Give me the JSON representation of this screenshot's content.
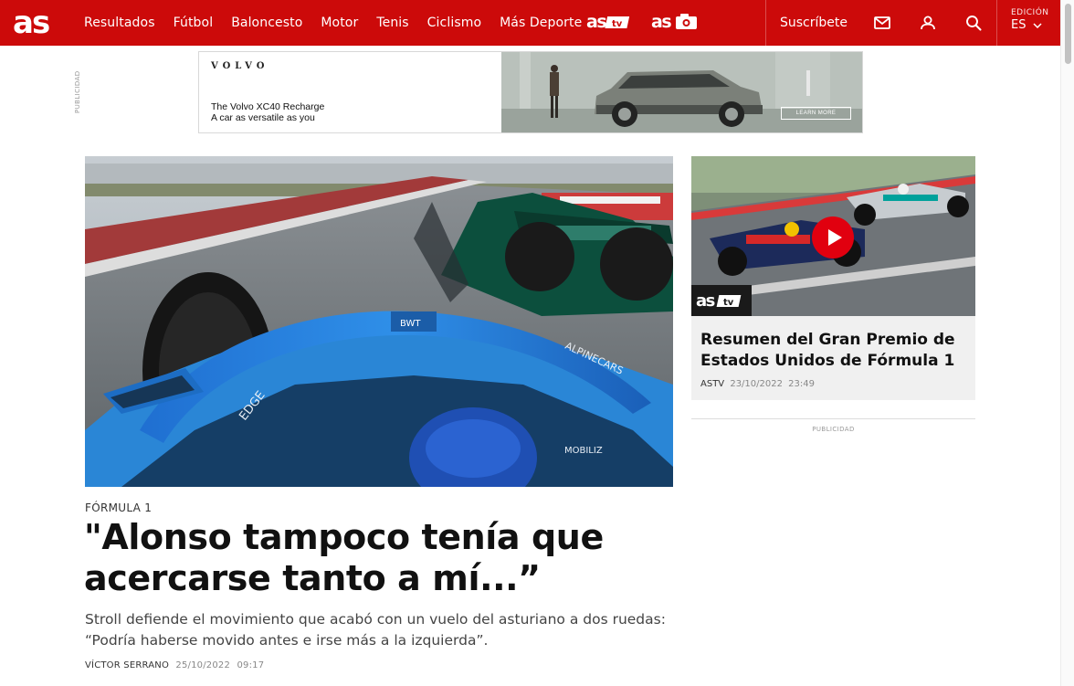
{
  "header": {
    "nav": [
      "Resultados",
      "Fútbol",
      "Baloncesto",
      "Motor",
      "Tenis",
      "Ciclismo",
      "Más Deporte"
    ],
    "subscribe_label": "Suscríbete",
    "edition_label": "EDICIÓN",
    "edition_value": "ES",
    "brand_color": "#cc0a0a"
  },
  "top_ad": {
    "label": "PUBLICIDAD",
    "brand": "VOLVO",
    "line1": "The Volvo XC40 Recharge",
    "line2": "A car as versatile as you",
    "cta": "LEARN MORE"
  },
  "main_article": {
    "kicker": "FÓRMULA 1",
    "title": "\"Alonso tampoco tenía que acercarse tanto a mí...”",
    "standfirst": "Stroll defiende el movimiento que acabó con un vuelo del asturiano a dos ruedas: “Podría haberse movido antes e irse más a la izquierda”.",
    "author": "VÍCTOR SERRANO",
    "date": "25/10/2022",
    "time": "09:17"
  },
  "side_article": {
    "title": "Resumen del Gran Premio de Estados Unidos de Fórmula 1",
    "source": "ASTV",
    "date": "23/10/2022",
    "time": "23:49",
    "play_color": "#e1000f"
  },
  "side_ad": {
    "label": "PUBLICIDAD"
  }
}
